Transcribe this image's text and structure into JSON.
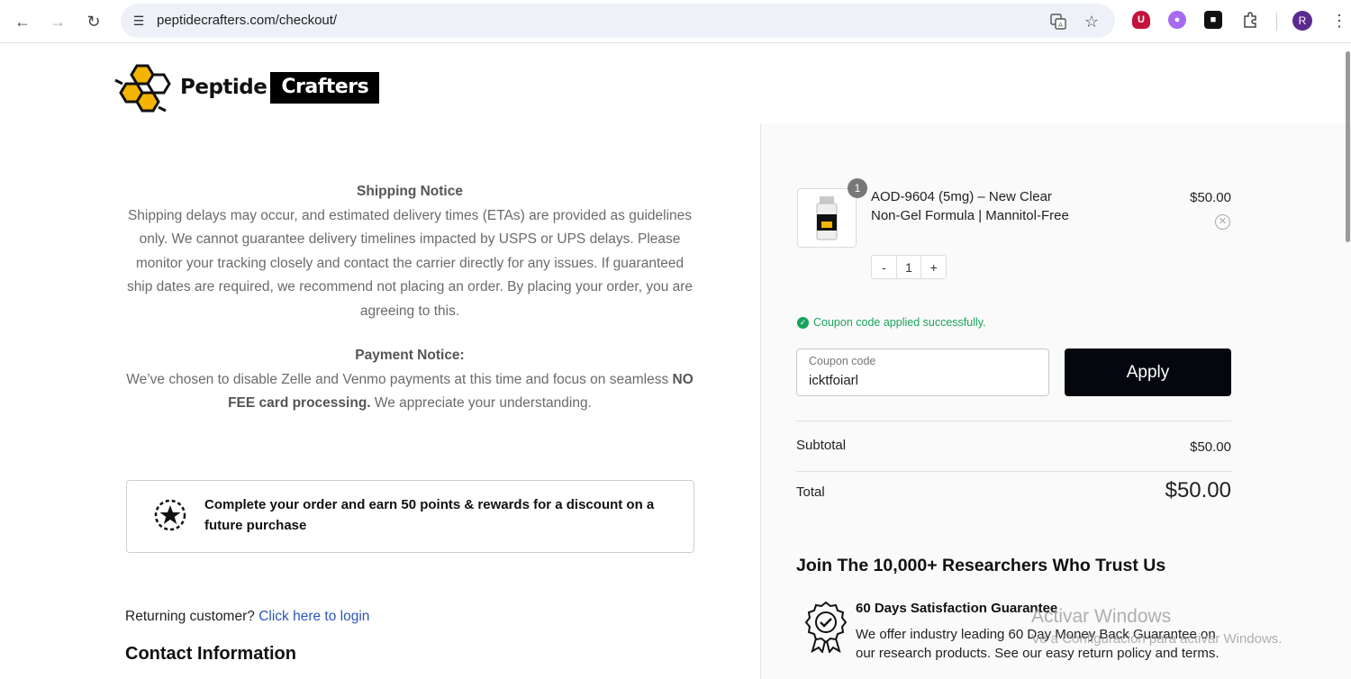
{
  "browser": {
    "url": "peptidecrafters.com/checkout/",
    "profile_initial": "R"
  },
  "logo": {
    "word1": "Peptide",
    "word2": "Crafters"
  },
  "shipping_notice": {
    "title": "Shipping Notice",
    "body": "Shipping delays may occur, and estimated delivery times (ETAs) are provided as guidelines only. We cannot guarantee delivery timelines impacted by USPS or UPS delays. Please monitor your tracking closely and contact the carrier directly for any issues. If guaranteed ship dates are required, we recommend not placing an order. By placing your order, you are agreeing to this."
  },
  "payment_notice": {
    "title": "Payment Notice:",
    "body_part1": "We’ve chosen to disable Zelle and Venmo payments at this time and focus on seamless",
    "body_bold": "NO FEE card processing.",
    "body_part2": "We appreciate your understanding."
  },
  "rewards": {
    "text": "Complete your order and earn 50 points & rewards for a discount on a future purchase"
  },
  "login": {
    "prompt": "Returning customer?",
    "link": "Click here to login"
  },
  "contact": {
    "title": "Contact Information"
  },
  "cart": {
    "item": {
      "quantity_badge": "1",
      "name": "AOD-9604 (5mg) – New Clear Non-Gel Formula | Mannitol-Free",
      "price": "$50.00",
      "stepper_minus": "-",
      "stepper_value": "1",
      "stepper_plus": "+"
    },
    "coupon_success": "Coupon code applied successfully.",
    "coupon_label": "Coupon code",
    "coupon_value": "icktfoiarl",
    "apply_label": "Apply",
    "subtotal_label": "Subtotal",
    "subtotal_value": "$50.00",
    "total_label": "Total",
    "total_value": "$50.00"
  },
  "trust": {
    "title": "Join The 10,000+ Researchers Who Trust Us",
    "guarantee_title": "60 Days Satisfaction Guarantee",
    "guarantee_text": "We offer industry leading 60 Day Money Back Guarantee on our research products. See our easy return policy and terms."
  },
  "watermark": {
    "line1": "Activar Windows",
    "line2": "Ve a Configuración para activar Windows."
  },
  "colors": {
    "accent_black": "#05070f",
    "link": "#2d55b8",
    "success": "#1aa35a",
    "logo_yellow": "#f4b400"
  }
}
